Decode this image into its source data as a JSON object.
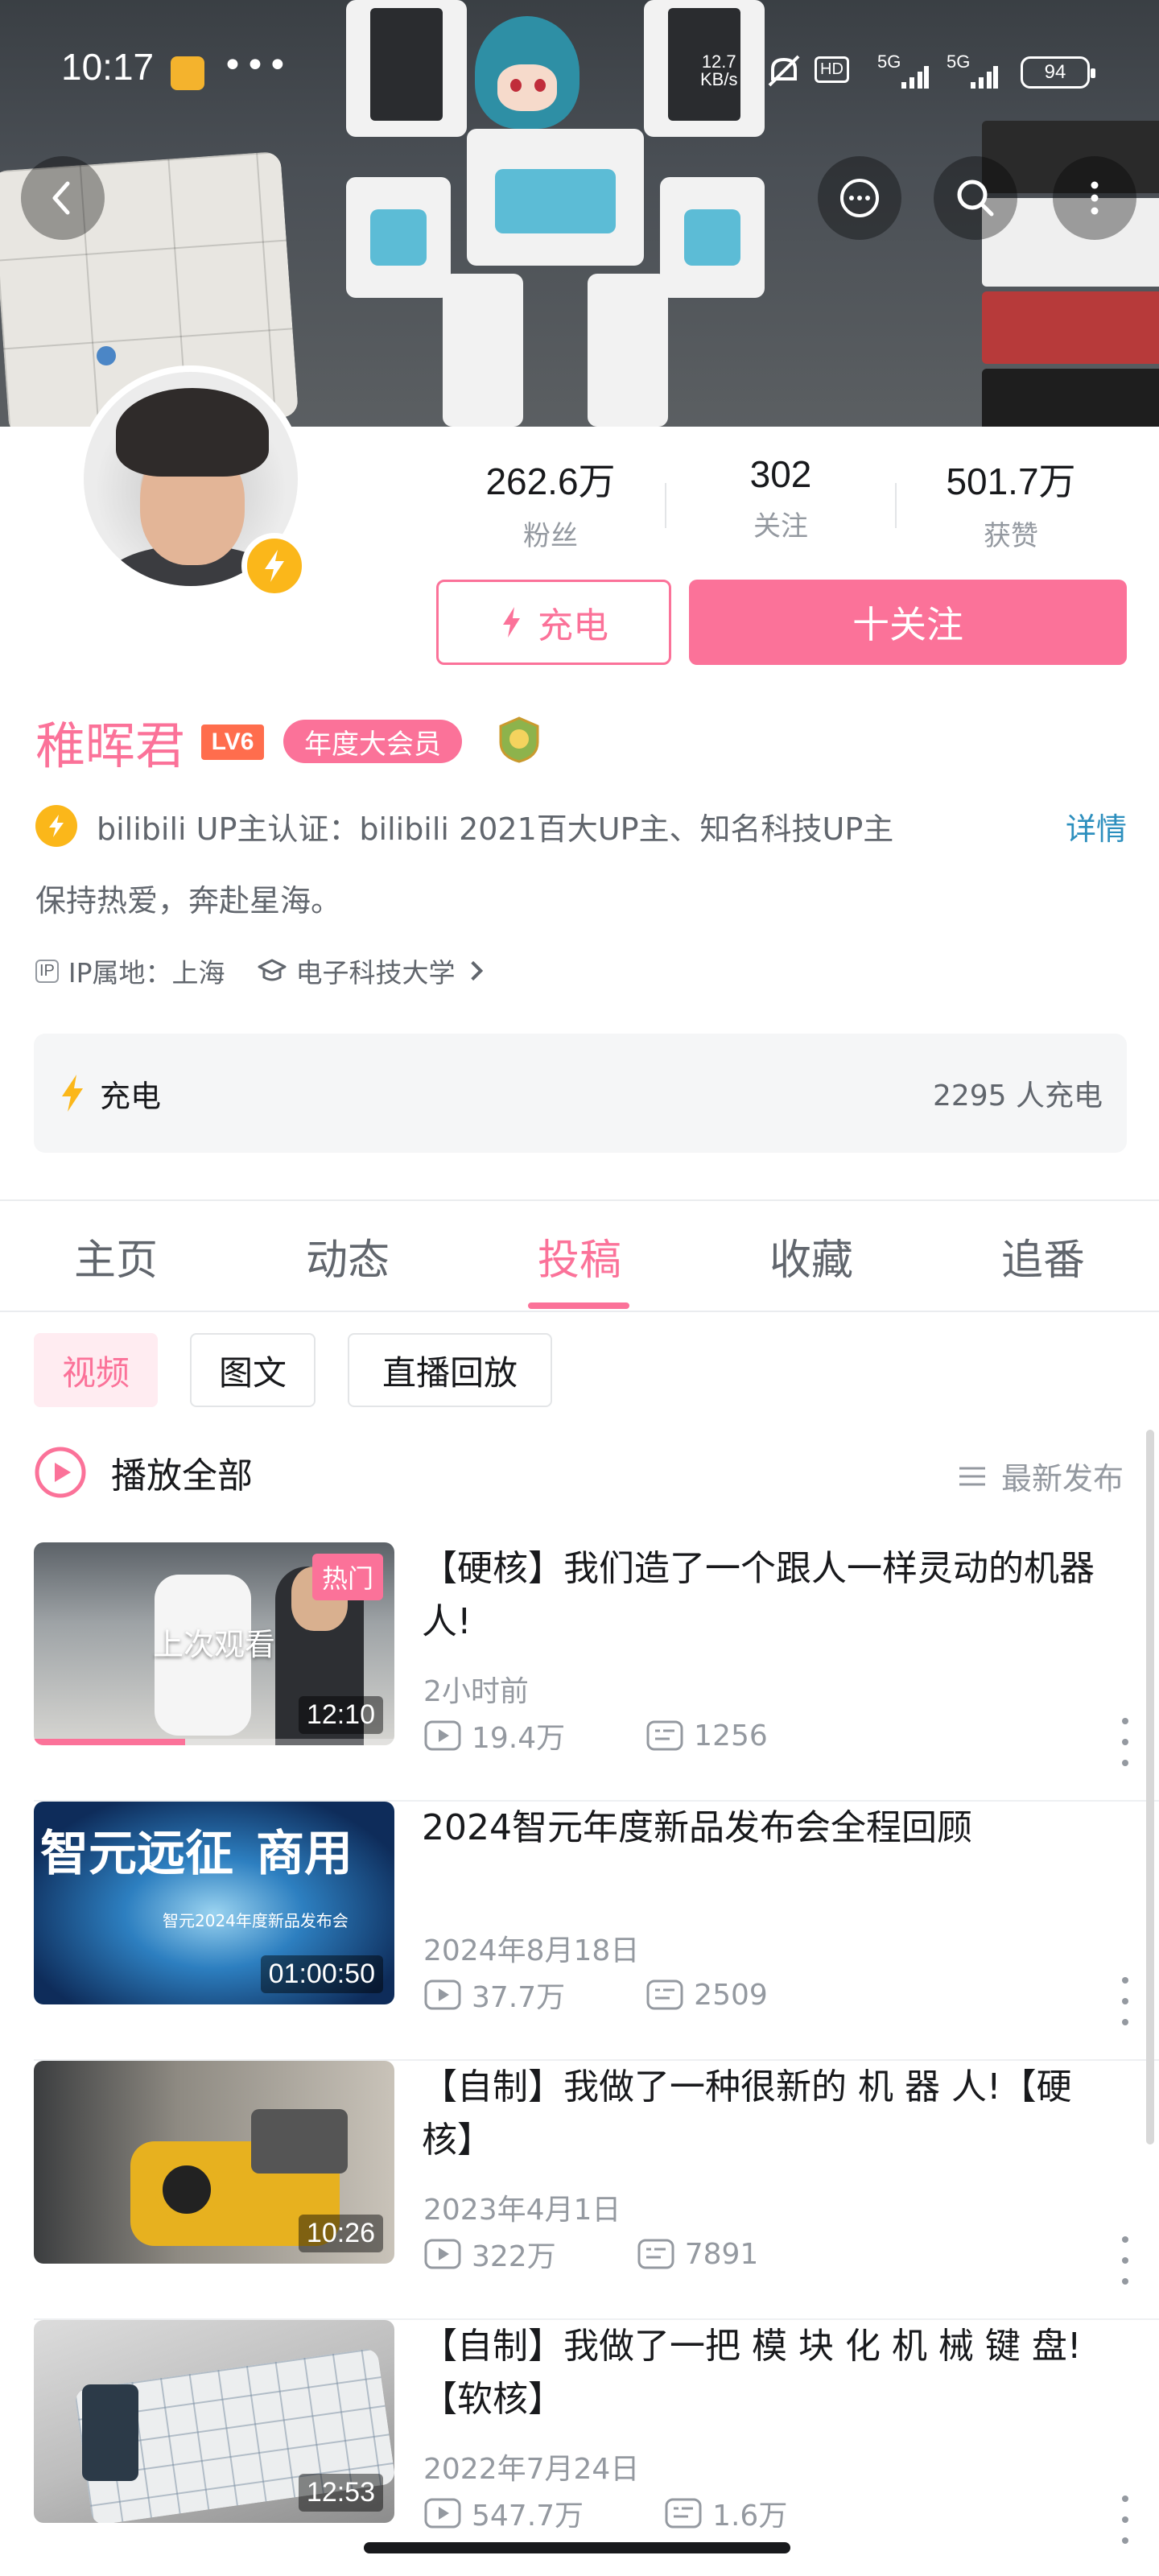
{
  "status_bar": {
    "time": "10:17",
    "speed_value": "12.7",
    "speed_unit": "KB/s",
    "hd": "HD",
    "signal1": "5G",
    "signal2": "5G",
    "battery": "94"
  },
  "header": {
    "back_icon": "chevron-left-icon",
    "message_icon": "chat-bubble-icon",
    "search_icon": "search-icon",
    "more_icon": "more-vertical-icon"
  },
  "profile": {
    "stats": [
      {
        "value": "262.6万",
        "label": "粉丝"
      },
      {
        "value": "302",
        "label": "关注"
      },
      {
        "value": "501.7万",
        "label": "获赞"
      }
    ],
    "charge_button": "充电",
    "follow_button": "十关注",
    "username": "稚晖君",
    "level": "LV6",
    "vip_label": "年度大会员",
    "certification": "bilibili UP主认证：bilibili 2021百大UP主、知名科技UP主",
    "cert_detail": "详情",
    "bio": "保持热爱，奔赴星海。",
    "ip_tag": "IP",
    "ip_location": "IP属地：上海",
    "school": "电子科技大学",
    "charge_panel_label": "充电",
    "charge_count": "2295 人充电"
  },
  "tabs": [
    {
      "label": "主页"
    },
    {
      "label": "动态"
    },
    {
      "label": "投稿"
    },
    {
      "label": "收藏"
    },
    {
      "label": "追番"
    }
  ],
  "filters": [
    {
      "label": "视频"
    },
    {
      "label": "图文"
    },
    {
      "label": "直播回放"
    }
  ],
  "list_header": {
    "play_all": "播放全部",
    "sort": "最新发布"
  },
  "videos": [
    {
      "title": "【硬核】我们造了一个跟人一样灵动的机器人!",
      "date": "2小时前",
      "views": "19.4万",
      "danmaku": "1256",
      "duration": "12:10",
      "hot_tag": "热门",
      "watched_label": "上次观看",
      "progress": 0.42
    },
    {
      "title": "2024智元年度新品发布会全程回顾",
      "date": "2024年8月18日",
      "views": "37.7万",
      "danmaku": "2509",
      "duration": "01:00:50",
      "thumb_text_1": "智元远征",
      "thumb_text_2": "商用",
      "thumb_text_3": "智元2024年度新品发布会"
    },
    {
      "title": "【自制】我做了一种很新的 机 器 人!【硬核】",
      "date": "2023年4月1日",
      "views": "322万",
      "danmaku": "7891",
      "duration": "10:26"
    },
    {
      "title": "【自制】我做了一把 模 块 化 机 械 键 盘!【软核】",
      "date": "2022年7月24日",
      "views": "547.7万",
      "danmaku": "1.6万",
      "duration": "12:53"
    }
  ]
}
